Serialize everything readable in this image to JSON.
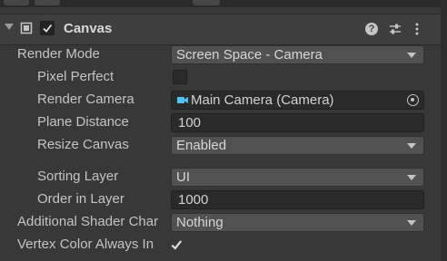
{
  "component": {
    "title": "Canvas",
    "enabled": true,
    "help_icon": "question-circle-icon",
    "presets_icon": "sliders-icon",
    "menu_icon": "kebab-menu-icon"
  },
  "fields": {
    "render_mode": {
      "label": "Render Mode",
      "value": "Screen Space - Camera"
    },
    "pixel_perfect": {
      "label": "Pixel Perfect",
      "checked": false
    },
    "render_camera": {
      "label": "Render Camera",
      "value": "Main Camera (Camera)"
    },
    "plane_distance": {
      "label": "Plane Distance",
      "value": "100"
    },
    "resize_canvas": {
      "label": "Resize Canvas",
      "value": "Enabled"
    },
    "sorting_layer": {
      "label": "Sorting Layer",
      "value": "UI"
    },
    "order_in_layer": {
      "label": "Order in Layer",
      "value": "1000"
    },
    "additional_shader": {
      "label": "Additional Shader Char",
      "value": "Nothing"
    },
    "vertex_color": {
      "label": "Vertex Color Always In",
      "checked": true
    }
  },
  "colors": {
    "background": "#383838",
    "field": "#2a2a2a",
    "dropdown": "#515151",
    "camera_icon": "#4fc3f7"
  }
}
